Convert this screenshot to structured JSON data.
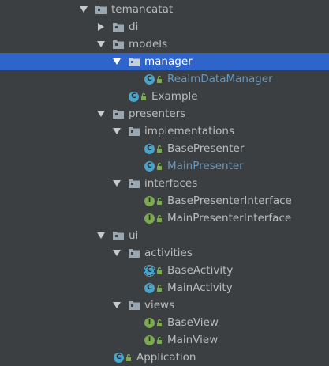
{
  "tree": {
    "temancatat": "temancatat",
    "di": "di",
    "models": "models",
    "manager": "manager",
    "realm_data_manager": "RealmDataManager",
    "example": "Example",
    "presenters": "presenters",
    "implementations": "implementations",
    "base_presenter": "BasePresenter",
    "main_presenter": "MainPresenter",
    "interfaces": "interfaces",
    "base_presenter_interface": "BasePresenterInterface",
    "main_presenter_interface": "MainPresenterInterface",
    "ui": "ui",
    "activities": "activities",
    "base_activity": "BaseActivity",
    "main_activity": "MainActivity",
    "views": "views",
    "base_view": "BaseView",
    "main_view": "MainView",
    "application": "Application"
  },
  "icons": {
    "class_badge": "C",
    "interface_badge": "I"
  },
  "colors": {
    "background": "#3c3f41",
    "selection": "#2f65ca",
    "text": "#bbbbbb",
    "modified_text": "#6897bb",
    "class_icon": "#4aa3c9",
    "interface_icon": "#7da953"
  }
}
